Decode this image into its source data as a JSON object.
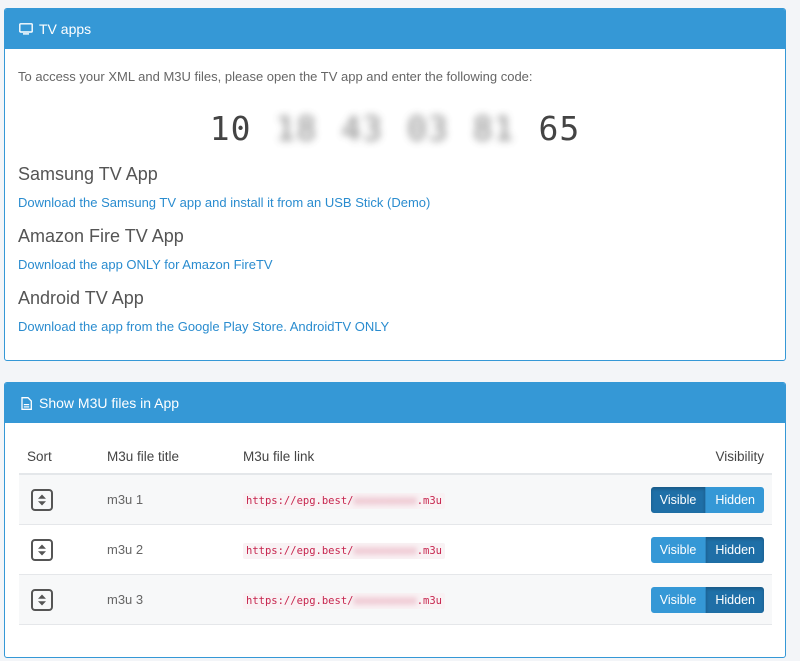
{
  "tv_panel": {
    "title": "TV apps",
    "intro": "To access your XML and M3U files, please open the TV app and enter the following code:",
    "code_parts": [
      "10",
      "18",
      "43",
      "03",
      "81",
      "65"
    ],
    "apps": [
      {
        "title": "Samsung TV App",
        "link": "Download the Samsung TV app and install it from an USB Stick (Demo)"
      },
      {
        "title": "Amazon Fire TV App",
        "link": "Download the app ONLY for Amazon FireTV"
      },
      {
        "title": "Android TV App",
        "link": "Download the app from the Google Play Store. AndroidTV ONLY"
      }
    ]
  },
  "m3u_panel": {
    "title": "Show M3U files in App",
    "headers": {
      "sort": "Sort",
      "title": "M3u file title",
      "link": "M3u file link",
      "visibility": "Visibility"
    },
    "rows": [
      {
        "title": "m3u 1",
        "link_prefix": "https://epg.best/",
        "link_hidden": "xxxxxxxxxx",
        "link_suffix": ".m3u",
        "visible_label": "Visible",
        "hidden_label": "Hidden",
        "state": "Visible"
      },
      {
        "title": "m3u 2",
        "link_prefix": "https://epg.best/",
        "link_hidden": "xxxxxxxxxx",
        "link_suffix": ".m3u",
        "visible_label": "Visible",
        "hidden_label": "Hidden",
        "state": "Hidden"
      },
      {
        "title": "m3u 3",
        "link_prefix": "https://epg.best/",
        "link_hidden": "xxxxxxxxxx",
        "link_suffix": ".m3u",
        "visible_label": "Visible",
        "hidden_label": "Hidden",
        "state": "Hidden"
      }
    ]
  },
  "icons": {
    "tv_panel": "tv-icon",
    "m3u_panel": "file-icon",
    "sort": "sort-icon"
  },
  "colors": {
    "primary": "#3598d6",
    "primary_active": "#1f6fa7",
    "link": "#2a8ccf",
    "code_text": "#c7254e"
  }
}
